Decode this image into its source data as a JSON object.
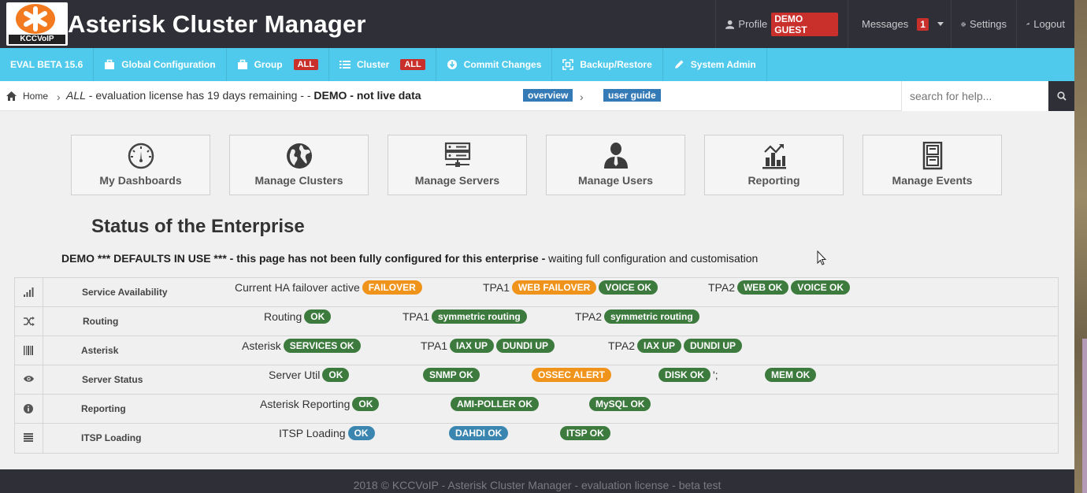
{
  "header": {
    "logo_text": "KCCVoIP",
    "title": "Asterisk Cluster Manager",
    "profile_label": "Profile",
    "profile_badge": "DEMO GUEST",
    "messages_label": "Messages",
    "messages_count": "1",
    "settings_label": "Settings",
    "logout_label": "Logout"
  },
  "menu": {
    "version": "EVAL BETA 15.6",
    "global_config": "Global Configuration",
    "group": "Group",
    "group_badge": "ALL",
    "cluster": "Cluster",
    "cluster_badge": "ALL",
    "commit": "Commit Changes",
    "backup": "Backup/Restore",
    "sysadmin": "System Admin"
  },
  "breadcrumb": {
    "home": "Home",
    "scope": "ALL",
    "message": " - evaluation license has 19 days remaining - - ",
    "demo": "DEMO - not live data",
    "overview": "overview",
    "user_guide": "user guide"
  },
  "search": {
    "placeholder": "search for help..."
  },
  "tiles": [
    "My Dashboards",
    "Manage Clusters",
    "Manage Servers",
    "Manage Users",
    "Reporting",
    "Manage Events"
  ],
  "status": {
    "title": "Status of the Enterprise",
    "note_bold": "DEMO *** DEFAULTS IN USE *** - this page has not been fully configured for this enterprise -",
    "note_rest": " waiting full configuration and customisation",
    "rows": {
      "service": {
        "name": "Service Availability",
        "t1": "Current HA failover active",
        "p1": "FAILOVER",
        "t2": "TPA1",
        "p2": "WEB FAILOVER",
        "p3": "VOICE OK",
        "t3": "TPA2",
        "p4": "WEB OK",
        "p5": "VOICE OK"
      },
      "routing": {
        "name": "Routing",
        "t1": "Routing",
        "p1": "OK",
        "t2": "TPA1",
        "p2": "symmetric routing",
        "t3": "TPA2",
        "p3": "symmetric routing"
      },
      "asterisk": {
        "name": "Asterisk",
        "t1": "Asterisk",
        "p1": "SERVICES OK",
        "t2": "TPA1",
        "p2": "IAX UP",
        "p3": "DUNDI UP",
        "t3": "TPA2",
        "p4": "IAX UP",
        "p5": "DUNDI UP"
      },
      "server": {
        "name": "Server Status",
        "t1": "Server Util",
        "p1": "OK",
        "p2": "SNMP OK",
        "p3": "OSSEC ALERT",
        "p4": "DISK OK",
        "stray": "';",
        "p5": "MEM OK"
      },
      "reporting": {
        "name": "Reporting",
        "t1": "Asterisk Reporting",
        "p1": "OK",
        "p2": "AMI-POLLER OK",
        "p3": "MySQL OK"
      },
      "itsp": {
        "name": "ITSP Loading",
        "t1": "ITSP Loading",
        "p1": "OK",
        "p2": "DAHDI OK",
        "p3": "ITSP OK"
      }
    }
  },
  "footer": "2018 © KCCVoIP - Asterisk Cluster Manager - evaluation license - beta test",
  "colors": {
    "header_bg": "#2f3037",
    "menu_bg": "#4fcaec",
    "ok_green": "#3d7a3d",
    "alert_orange": "#f0931a",
    "info_blue": "#3a86b0",
    "badge_red": "#c9302c"
  }
}
